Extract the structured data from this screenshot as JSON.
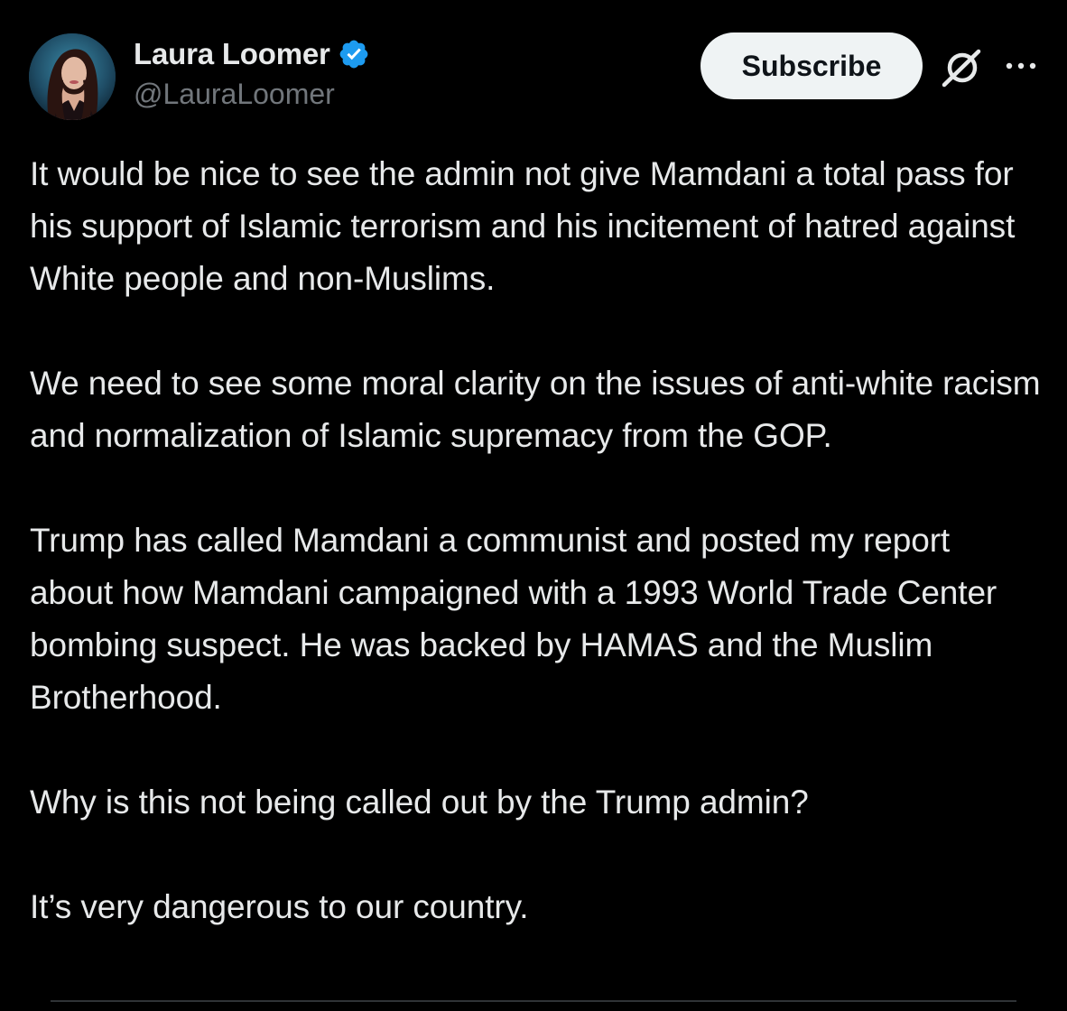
{
  "author": {
    "display_name": "Laura Loomer",
    "handle": "@LauraLoomer",
    "verified": true,
    "verified_icon": "verified-badge-icon",
    "avatar_icon": "profile-photo"
  },
  "actions": {
    "subscribe_label": "Subscribe",
    "grok_icon": "grok-icon",
    "more_icon": "more-options-icon"
  },
  "tweet": {
    "paragraphs": [
      "It would be nice to see the admin not give Mamdani a total pass for his support of Islamic terrorism and his incitement of hatred against White people and non-Muslims.",
      "We need to see some moral clarity on the issues of anti-white racism and normalization of Islamic supremacy from the GOP.",
      "Trump has called Mamdani a communist and posted my report about how Mamdani campaigned with a 1993 World Trade Center bombing suspect. He was backed by HAMAS and the Muslim Brotherhood.",
      "Why is this not being called out by the Trump admin?",
      "It’s very dangerous to our country."
    ]
  },
  "colors": {
    "background": "#000000",
    "text_primary": "#e7e9ea",
    "text_secondary": "#71767b",
    "verified_blue": "#1d9bf0",
    "button_bg": "#eff3f4",
    "button_text": "#0f1419"
  }
}
